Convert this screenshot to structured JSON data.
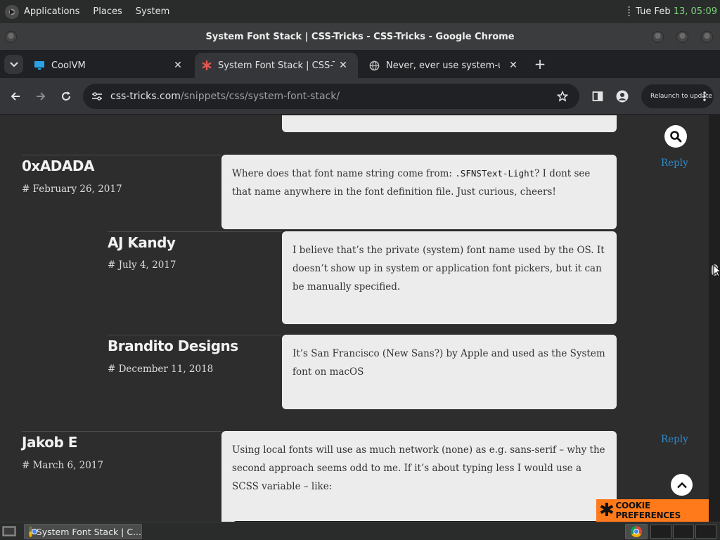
{
  "panel": {
    "menus": [
      "Applications",
      "Places",
      "System"
    ],
    "clock_prefix": "Tue Feb ",
    "clock_time": "13, 05:09"
  },
  "window": {
    "title": "System Font Stack | CSS-Tricks - CSS-Tricks - Google Chrome"
  },
  "tabs": [
    {
      "label": "CoolVM",
      "icon": "monitor-icon",
      "active": false
    },
    {
      "label": "System Font Stack | CSS-Tricks",
      "icon": "css-tricks-star-icon",
      "active": true
    },
    {
      "label": "Never, ever use system-ui as",
      "icon": "globe-icon",
      "active": false
    }
  ],
  "toolbar": {
    "url_host": "css-tricks.com",
    "url_path": "/snippets/css/system-font-stack/",
    "relaunch_label": "Relaunch to update"
  },
  "comments": [
    {
      "author": "0xADADA",
      "date": "# February 26, 2017",
      "text_before": "Where does that font name string come from: ",
      "code": ".SFNSText-Light",
      "text_after": "? I dont see that name anywhere in the font definition file. Just curious, cheers!",
      "reply": "Reply"
    },
    {
      "author": "AJ Kandy",
      "date": "# July 4, 2017",
      "text": "I believe that’s the private (system) font name used by the OS. It doesn’t show up in system or application font pickers, but it can be manually specified."
    },
    {
      "author": "Brandito Designs",
      "date": "# December 11, 2018",
      "text": "It’s San Francisco (New Sans?) by Apple and used as the System font on macOS"
    },
    {
      "author": "Jakob E",
      "date": "# March 6, 2017",
      "text": "Using local fonts will use as much network (none) as e.g. sans-serif – why the second approach seems odd to me. If it’s about typing less I would use a SCSS variable – like:",
      "reply": "Reply"
    }
  ],
  "cookie": {
    "label": "COOKIE PREFERENCES"
  },
  "taskbar": {
    "task_label": "System Font Stack | C..."
  },
  "colors": {
    "accent_link": "#2e8ac8",
    "cookie_bg": "#ff7a1a",
    "clock_green": "#7bd67b"
  }
}
